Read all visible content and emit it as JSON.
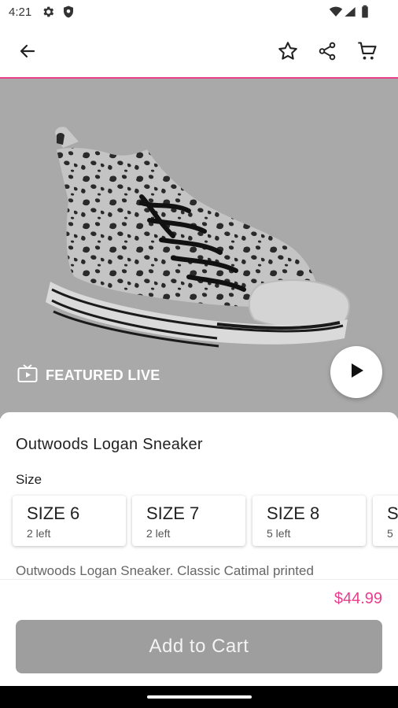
{
  "status_bar": {
    "time": "4:21"
  },
  "product": {
    "title": "Outwoods Logan Sneaker",
    "featured_label": "FEATURED LIVE",
    "size_heading": "Size",
    "sizes": [
      {
        "label": "SIZE 6",
        "stock": "2 left"
      },
      {
        "label": "SIZE 7",
        "stock": "2 left"
      },
      {
        "label": "SIZE 8",
        "stock": "5 left"
      },
      {
        "label": "S",
        "stock": "5"
      }
    ],
    "description": "Outwoods Logan Sneaker. Classic Catimal printed",
    "price": "$44.99"
  },
  "actions": {
    "add_to_cart": "Add to Cart"
  },
  "colors": {
    "accent": "#e83e8c",
    "button_disabled": "#9e9e9e",
    "image_bg": "#a9a9a9"
  },
  "icons": [
    "settings-icon",
    "shield-icon",
    "wifi-icon",
    "signal-icon",
    "battery-icon",
    "back-arrow-icon",
    "star-icon",
    "share-icon",
    "cart-icon",
    "live-tv-icon",
    "play-icon"
  ]
}
